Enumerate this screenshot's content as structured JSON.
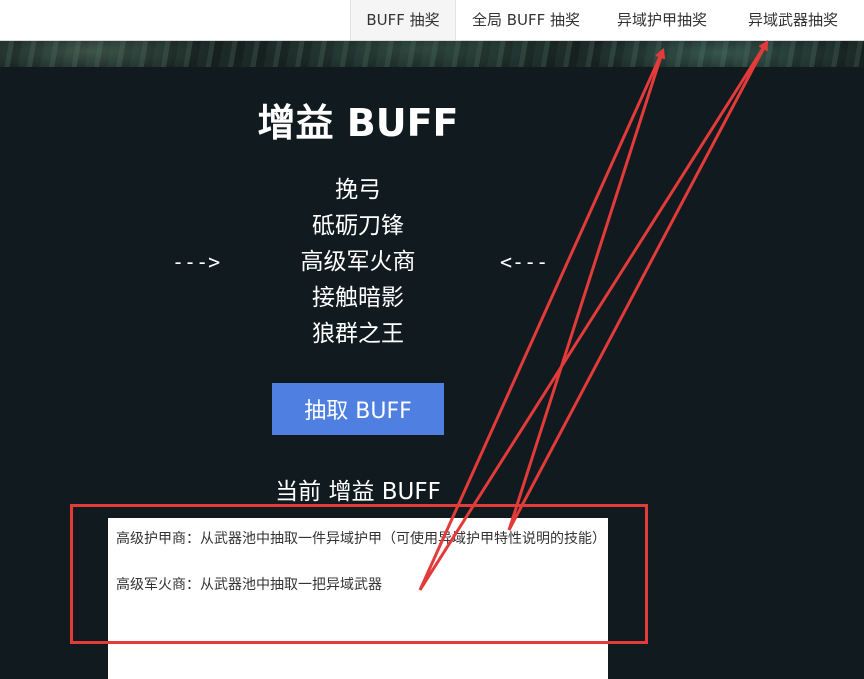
{
  "nav": {
    "tabs": [
      {
        "label": "BUFF 抽奖",
        "active": true
      },
      {
        "label": "全局 BUFF 抽奖",
        "active": false
      },
      {
        "label": "异域护甲抽奖",
        "active": false
      },
      {
        "label": "异域武器抽奖",
        "active": false
      }
    ]
  },
  "main": {
    "title": "增益 BUFF",
    "buff_list": [
      "挽弓",
      "砥砺刀锋",
      "高级军火商",
      "接触暗影",
      "狼群之王"
    ],
    "pointer_left": "--->",
    "pointer_right": "<---",
    "draw_button": "抽取 BUFF",
    "current_heading": "当前 增益 BUFF",
    "current_results": [
      "高级护甲商：从武器池中抽取一件异域护甲（可使用异域护甲特性说明的技能）",
      "高级军火商：从武器池中抽取一把异域武器"
    ]
  },
  "colors": {
    "background": "#111a1f",
    "button": "#4f7fe0",
    "annotation": "#e33a3a"
  }
}
